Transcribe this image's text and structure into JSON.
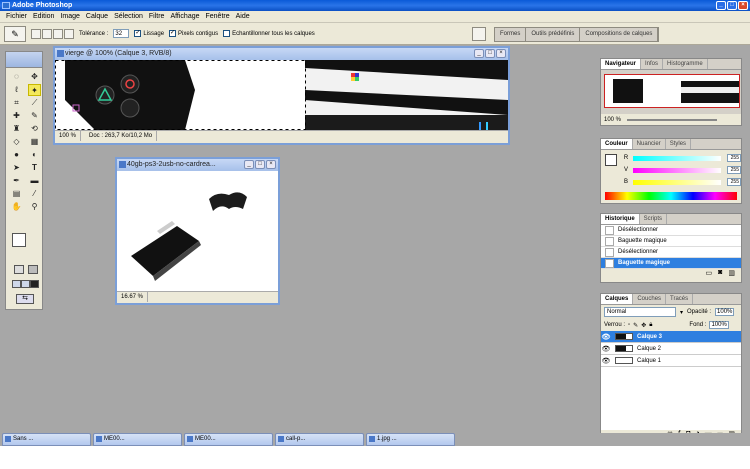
{
  "app": {
    "title": "Adobe Photoshop"
  },
  "menu": [
    "Fichier",
    "Edition",
    "Image",
    "Calque",
    "Sélection",
    "Filtre",
    "Affichage",
    "Fenêtre",
    "Aide"
  ],
  "options": {
    "tolerance_label": "Tolérance :",
    "tolerance_value": "32",
    "lissage": "Lissage",
    "pixels_contigus": "Pixels contigus",
    "echantillonner": "Echantillonner tous les calques"
  },
  "palette_well": [
    "Formes",
    "Outils prédéfinis",
    "Compositions de calques"
  ],
  "doc1": {
    "title": "vierge @ 100% (Calque 3, RVB/8)",
    "zoom": "100 %",
    "doc_info": "Doc : 263,7 Ko/10,2 Mo"
  },
  "doc2": {
    "title": "40gb-ps3-2usb-no-cardrea...",
    "zoom": "16.67 %"
  },
  "navigator": {
    "tabs": [
      "Navigateur",
      "Infos",
      "Histogramme"
    ],
    "zoom": "100 %"
  },
  "color": {
    "tabs": [
      "Couleur",
      "Nuancier",
      "Styles"
    ],
    "channels": [
      {
        "label": "R",
        "value": "255"
      },
      {
        "label": "V",
        "value": "255"
      },
      {
        "label": "B",
        "value": "255"
      }
    ]
  },
  "history": {
    "tabs": [
      "Historique",
      "Scripts"
    ],
    "items": [
      "Désélectionner",
      "Baguette magique",
      "Désélectionner",
      "Baguette magique"
    ]
  },
  "layers": {
    "tabs": [
      "Calques",
      "Couches",
      "Tracés"
    ],
    "blend": "Normal",
    "opacity_label": "Opacité :",
    "opacity_value": "100%",
    "lock_label": "Verrou :",
    "fill_label": "Fond :",
    "fill_value": "100%",
    "items": [
      "Calque 3",
      "Calque 2",
      "Calque 1"
    ]
  },
  "taskbar": [
    "Sans ...",
    "ME00...",
    "ME00...",
    "call-p...",
    "1.jpg ..."
  ]
}
